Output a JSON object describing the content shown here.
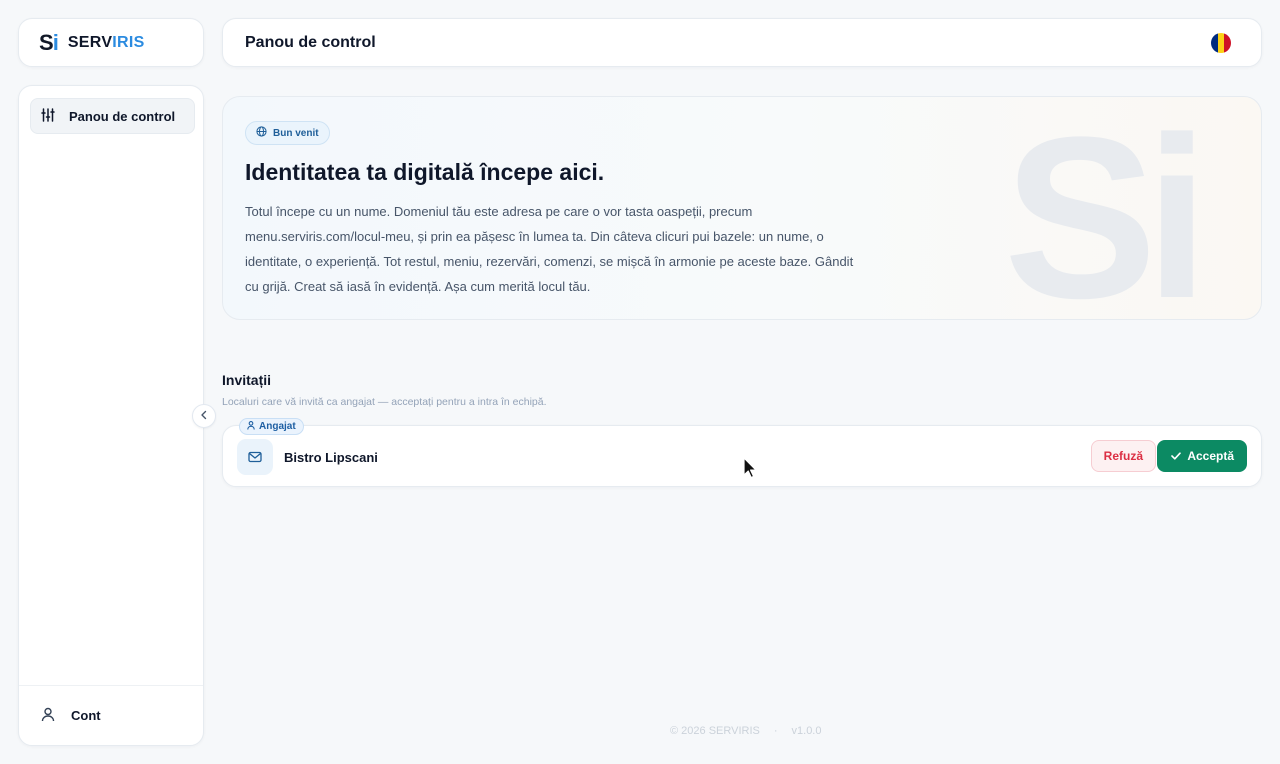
{
  "brand": {
    "mark_s": "S",
    "mark_i": "i",
    "name_part1": "SERV",
    "name_part2": "IRIS",
    "accent": "#2b8be0"
  },
  "header": {
    "title": "Panou de control",
    "language_flag": "romania-flag-icon"
  },
  "sidebar": {
    "items": [
      {
        "label": "Panou de control",
        "icon": "sliders-icon",
        "active": true
      }
    ],
    "footer": {
      "label": "Cont",
      "icon": "user-icon"
    },
    "collapse_icon": "chevron-left-icon"
  },
  "hero": {
    "pill_label": "Bun venit",
    "pill_icon": "globe-icon",
    "title": "Identitatea ta digitală începe aici.",
    "text": "Totul începe cu un nume. Domeniul tău este adresa pe care o vor tasta oaspeții, precum menu.serviris.com/locul-meu, și prin ea pășesc în lumea ta. Din câteva clicuri pui bazele: un nume, o identitate, o experiență. Tot restul, meniu, rezervări, comenzi, se mișcă în armonie pe aceste baze. Gândit cu grijă. Creat să iasă în evidență. Așa cum merită locul tău.",
    "watermark": "Si"
  },
  "invitations": {
    "title": "Invitații",
    "subtitle": "Localuri care vă invită ca angajat — acceptați pentru a intra în echipă.",
    "items": [
      {
        "badge": "Angajat",
        "name": "Bistro Lipscani",
        "refuse_label": "Refuză",
        "accept_label": "Acceptă"
      }
    ]
  },
  "footer": {
    "copyright": "© 2026 SERVIRIS",
    "separator": "·",
    "version": "v1.0.0"
  },
  "colors": {
    "accept": "#0c8a63",
    "refuse": "#dc2f44",
    "flag": [
      "#002b7f",
      "#fcd116",
      "#ce1126"
    ]
  }
}
